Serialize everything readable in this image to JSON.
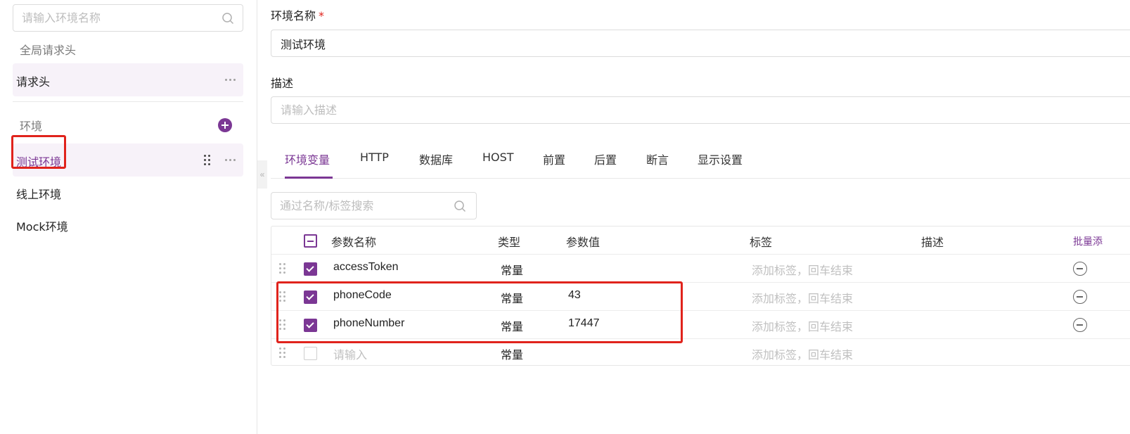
{
  "sidebar": {
    "search_placeholder": "请输入环境名称",
    "global_headers_title": "全局请求头",
    "headers_item": "请求头",
    "env_section_title": "环境",
    "env_items": [
      {
        "label": "测试环境",
        "active": true
      },
      {
        "label": "线上环境",
        "active": false
      },
      {
        "label": "Mock环境",
        "active": false
      }
    ],
    "collapse_glyph": "«"
  },
  "form": {
    "name_label": "环境名称",
    "required_mark": "*",
    "name_value": "测试环境",
    "desc_label": "描述",
    "desc_placeholder": "请输入描述"
  },
  "tabs": [
    {
      "label": "环境变量",
      "active": true
    },
    {
      "label": "HTTP",
      "active": false
    },
    {
      "label": "数据库",
      "active": false
    },
    {
      "label": "HOST",
      "active": false
    },
    {
      "label": "前置",
      "active": false
    },
    {
      "label": "后置",
      "active": false
    },
    {
      "label": "断言",
      "active": false
    },
    {
      "label": "显示设置",
      "active": false
    }
  ],
  "var_search_placeholder": "通过名称/标签搜索",
  "table": {
    "headers": {
      "name": "参数名称",
      "type": "类型",
      "value": "参数值",
      "tag": "标签",
      "desc": "描述",
      "batch": "批量添"
    },
    "rows": [
      {
        "name": "accessToken",
        "type": "常量",
        "value": "",
        "tag_placeholder": "添加标签，回车结束",
        "checked": true
      },
      {
        "name": "phoneCode",
        "type": "常量",
        "value": "43",
        "tag_placeholder": "添加标签，回车结束",
        "checked": true
      },
      {
        "name": "phoneNumber",
        "type": "常量",
        "value": "17447",
        "tag_placeholder": "添加标签，回车结束",
        "checked": true
      }
    ],
    "new_row": {
      "name_placeholder": "请输入",
      "type": "常量",
      "tag_placeholder": "添加标签，回车结束"
    }
  },
  "colors": {
    "accent": "#7b3794",
    "highlight_box": "#e0231c",
    "active_bg": "#f7f2f9"
  },
  "icons": [
    "search-icon",
    "more-icon",
    "plus-icon",
    "drag-handle-icon",
    "minus-circle-icon",
    "check-icon"
  ]
}
